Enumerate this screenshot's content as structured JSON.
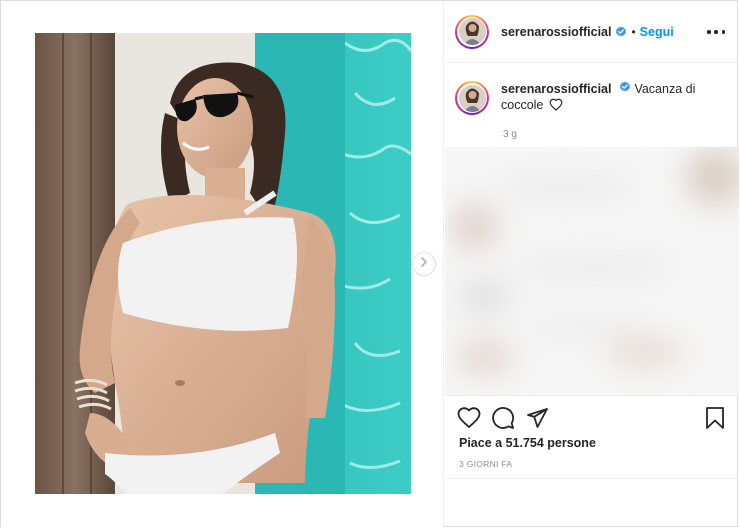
{
  "post": {
    "username": "serenarossiofficial",
    "follow_label": "Segui",
    "separator": "•",
    "caption_text": "Vacanza di coccole",
    "caption_time": "3 g",
    "likes_text": "Piace a 51.754 persone",
    "date_text": "3 GIORNI FA"
  },
  "icons": {
    "verified": "verified-badge-icon",
    "more": "more-options-icon",
    "like": "heart-icon",
    "comment": "comment-icon",
    "share": "paper-plane-icon",
    "save": "bookmark-icon",
    "next": "chevron-right-icon"
  },
  "colors": {
    "accent": "#0095f6",
    "pool": "#2bb7b3",
    "text": "#262626",
    "muted": "#8e8e8e"
  }
}
